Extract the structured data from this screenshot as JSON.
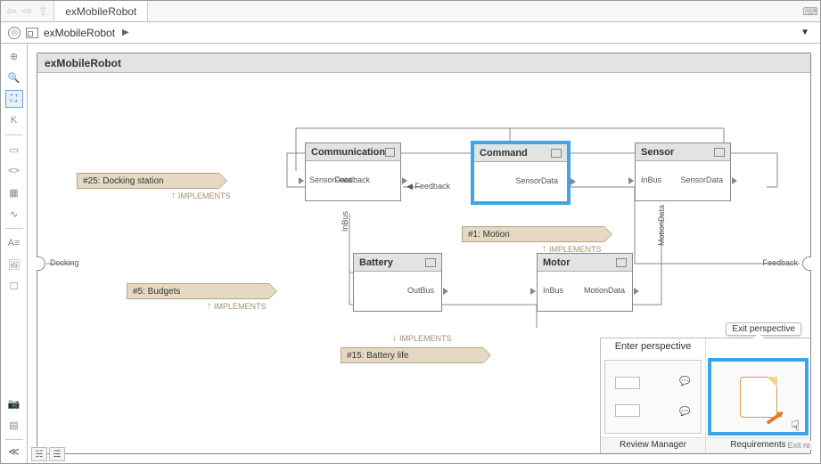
{
  "tab": {
    "title": "exMobileRobot"
  },
  "breadcrumb": {
    "model": "exMobileRobot"
  },
  "canvas": {
    "title": "exMobileRobot"
  },
  "outer_ports": {
    "left": "Docking",
    "right": "Feedback"
  },
  "blocks": {
    "communication": {
      "title": "Communication",
      "ports": {
        "in_left": "SensorData",
        "in_mid": "Feedback",
        "out_right": "Feedback",
        "bottom": "InBus"
      }
    },
    "command": {
      "title": "Command",
      "ports": {
        "out_right": "SensorData"
      }
    },
    "sensor": {
      "title": "Sensor",
      "ports": {
        "in_left": "InBus",
        "out_right": "SensorData",
        "bottom": "MotionData"
      }
    },
    "battery": {
      "title": "Battery",
      "ports": {
        "out_right": "OutBus"
      }
    },
    "motor": {
      "title": "Motor",
      "ports": {
        "in_left": "InBus",
        "out_right": "MotionData"
      }
    }
  },
  "requirements": {
    "r25": {
      "label": "#25: Docking station",
      "impl": "IMPLEMENTS"
    },
    "r5": {
      "label": "#5: Budgets",
      "impl": "IMPLEMENTS"
    },
    "r1": {
      "label": "#1: Motion",
      "impl": "IMPLEMENTS"
    },
    "r15": {
      "label": "#15: Battery life",
      "impl": "IMPLEMENTS"
    }
  },
  "perspective": {
    "enter": {
      "header": "Enter perspective",
      "title": "Review Manager"
    },
    "exit": {
      "header": "Exit perspective",
      "title": "Requirements",
      "tooltip": "Exit re"
    }
  }
}
